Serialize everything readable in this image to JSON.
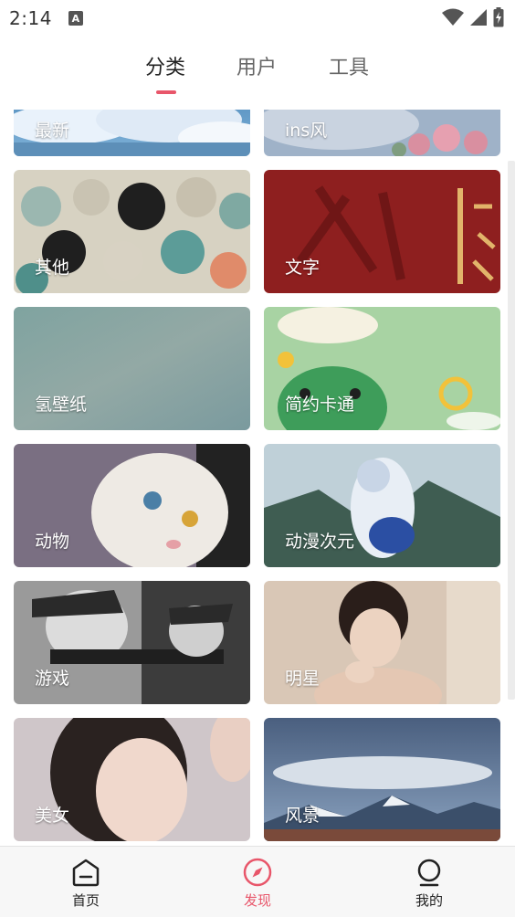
{
  "status": {
    "time": "2:14",
    "notif_badge": "A"
  },
  "tabs": [
    {
      "label": "分类",
      "active": true
    },
    {
      "label": "用户",
      "active": false
    },
    {
      "label": "工具",
      "active": false
    }
  ],
  "categories": [
    {
      "label": "最新"
    },
    {
      "label": "ins风"
    },
    {
      "label": "其他"
    },
    {
      "label": "文字"
    },
    {
      "label": "氢壁纸"
    },
    {
      "label": "简约卡通"
    },
    {
      "label": "动物"
    },
    {
      "label": "动漫次元"
    },
    {
      "label": "游戏"
    },
    {
      "label": "明星"
    },
    {
      "label": "美女"
    },
    {
      "label": "风景"
    }
  ],
  "bottom_nav": [
    {
      "label": "首页",
      "icon": "home-icon",
      "active": false
    },
    {
      "label": "发现",
      "icon": "compass-icon",
      "active": true
    },
    {
      "label": "我的",
      "icon": "profile-icon",
      "active": false
    }
  ],
  "colors": {
    "accent": "#e8566a"
  }
}
